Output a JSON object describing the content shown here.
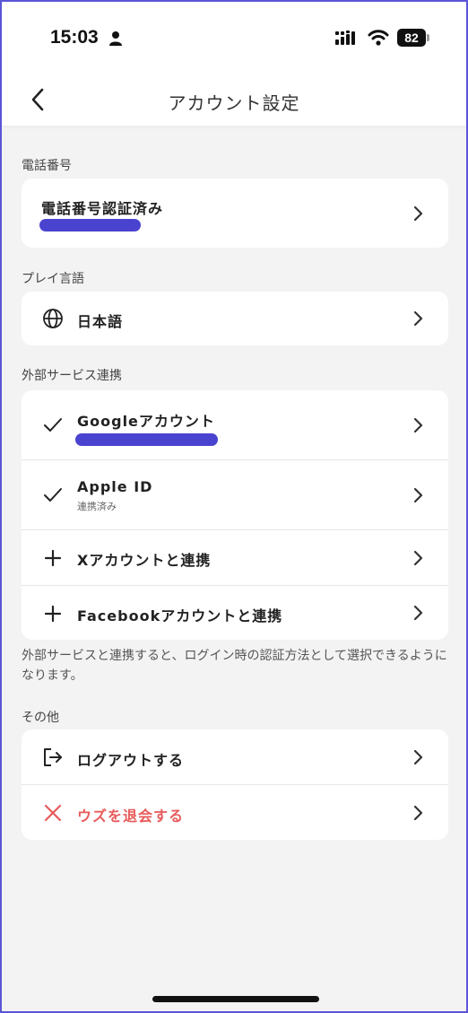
{
  "status_bar": {
    "time": "15:03",
    "battery": "82"
  },
  "nav": {
    "title": "アカウント設定"
  },
  "sections": {
    "phone": {
      "label": "電話番号",
      "title": "電話番号認証済み"
    },
    "language": {
      "label": "プレイ言語",
      "title": "日本語"
    },
    "services": {
      "label": "外部サービス連携",
      "items": [
        {
          "title": "Googleアカウント",
          "subtitle": "",
          "icon": "check-icon"
        },
        {
          "title": "Apple ID",
          "subtitle": "連携済み",
          "icon": "check-icon"
        },
        {
          "title": "Xアカウントと連携",
          "subtitle": "",
          "icon": "plus-icon"
        },
        {
          "title": "Facebookアカウントと連携",
          "subtitle": "",
          "icon": "plus-icon"
        }
      ],
      "note": "外部サービスと連携すると、ログイン時の認証方法として選択できるようになります。"
    },
    "other": {
      "label": "その他",
      "logout": "ログアウトする",
      "withdraw": "ウズを退会する"
    }
  },
  "colors": {
    "accent": "#4a43d0",
    "danger": "#e85a5a",
    "background": "#f3f3f3",
    "card": "#ffffff"
  }
}
